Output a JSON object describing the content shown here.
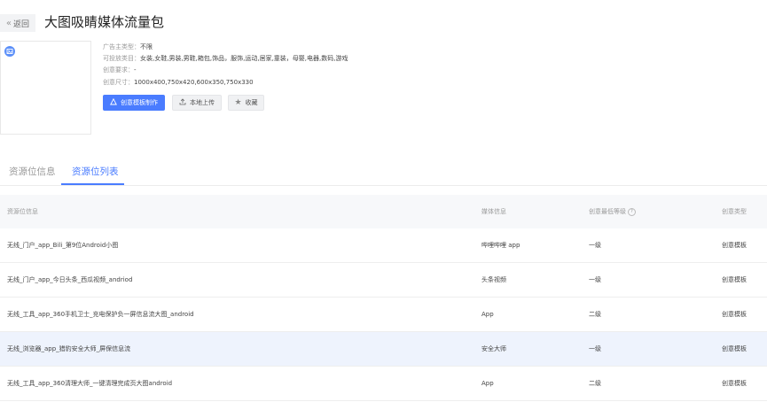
{
  "header": {
    "back_label": "返回",
    "title": "大图吸睛媒体流量包"
  },
  "info": {
    "advertiser_type_label": "广告主类型：",
    "advertiser_type_value": "不限",
    "categories_label": "可投放类目：",
    "categories_value": "女装,女鞋,男装,男鞋,箱包,饰品，服饰,运动,居家,童装，母婴,电器,数码,游戏",
    "requirement_label": "创意要求：",
    "requirement_value": "-",
    "size_label": "创意尺寸：",
    "size_value": "1000x400,750x420,600x350,750x330"
  },
  "actions": {
    "template_label": "创意模板制作",
    "upload_label": "本地上传",
    "favorite_label": "收藏"
  },
  "tabs": [
    {
      "label": "资源位信息",
      "active": false
    },
    {
      "label": "资源位列表",
      "active": true
    }
  ],
  "table": {
    "columns": [
      "资源位信息",
      "媒体信息",
      "创意最低等级",
      "创意类型"
    ],
    "rows": [
      {
        "name": "无线_门户_app_Bili_第9位Android小图",
        "media": "哔哩哔哩 app",
        "level": "一级",
        "type": "创意模板"
      },
      {
        "name": "无线_门户_app_今日头条_西瓜视频_andriod",
        "media": "头条视频",
        "level": "一级",
        "type": "创意模板"
      },
      {
        "name": "无线_工具_app_360手机卫士_充电保护负一屏信息流大图_android",
        "media": "App",
        "level": "二级",
        "type": "创意模板"
      },
      {
        "name": "无线_浏览器_app_猎豹安全大师_屏保信息流",
        "media": "安全大师",
        "level": "一级",
        "type": "创意模板"
      },
      {
        "name": "无线_工具_app_360清理大师_一键清理完成页大图android",
        "media": "App",
        "level": "二级",
        "type": "创意模板"
      }
    ],
    "highlighted_row": 3
  },
  "colors": {
    "accent": "#4a7cff",
    "highlight_row": "#eef3fd",
    "header_bg": "#f7f8fa"
  },
  "icons": [
    "double-chevron-left-icon",
    "image-icon",
    "template-icon",
    "upload-icon",
    "star-icon",
    "info-icon"
  ]
}
